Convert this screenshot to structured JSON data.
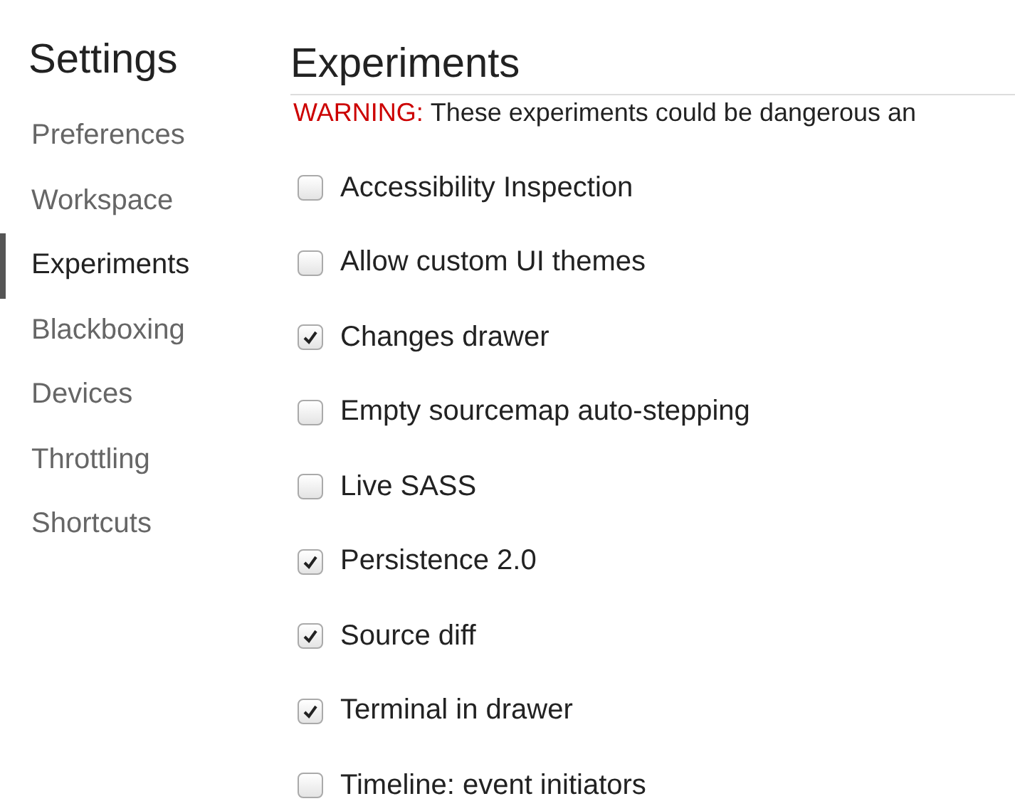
{
  "sidebar": {
    "title": "Settings",
    "items": [
      {
        "label": "Preferences",
        "selected": false
      },
      {
        "label": "Workspace",
        "selected": false
      },
      {
        "label": "Experiments",
        "selected": true
      },
      {
        "label": "Blackboxing",
        "selected": false
      },
      {
        "label": "Devices",
        "selected": false
      },
      {
        "label": "Throttling",
        "selected": false
      },
      {
        "label": "Shortcuts",
        "selected": false
      }
    ]
  },
  "panel": {
    "title": "Experiments",
    "warning_label": "WARNING:",
    "warning_text": "These experiments could be dangerous an",
    "experiments": [
      {
        "label": "Accessibility Inspection",
        "checked": false
      },
      {
        "label": "Allow custom UI themes",
        "checked": false
      },
      {
        "label": "Changes drawer",
        "checked": true
      },
      {
        "label": "Empty sourcemap auto-stepping",
        "checked": false
      },
      {
        "label": "Live SASS",
        "checked": false
      },
      {
        "label": "Persistence 2.0",
        "checked": true
      },
      {
        "label": "Source diff",
        "checked": true
      },
      {
        "label": "Terminal in drawer",
        "checked": true
      },
      {
        "label": "Timeline: event initiators",
        "checked": false
      }
    ]
  }
}
